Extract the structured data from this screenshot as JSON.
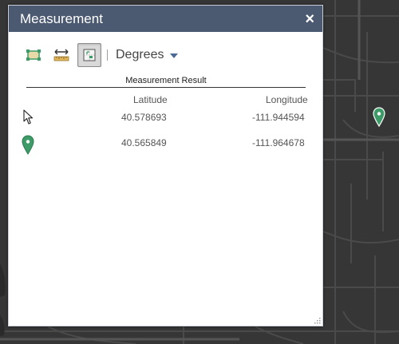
{
  "widget": {
    "title": "Measurement",
    "close_label": "×",
    "tools": [
      {
        "name": "area-tool-icon"
      },
      {
        "name": "distance-tool-icon"
      },
      {
        "name": "location-tool-icon",
        "active": true
      }
    ],
    "unit_label": "Degrees",
    "result_title": "Measurement Result",
    "columns": [
      "Latitude",
      "Longitude"
    ],
    "rows": [
      {
        "icon": "cursor-icon",
        "latitude": "40.578693",
        "longitude": "-111.944594"
      },
      {
        "icon": "marker-icon",
        "latitude": "40.565849",
        "longitude": "-111.964678"
      }
    ]
  },
  "colors": {
    "titlebar": "#4b5a71",
    "marker": "#3d9b68",
    "map_background": "#363636"
  }
}
